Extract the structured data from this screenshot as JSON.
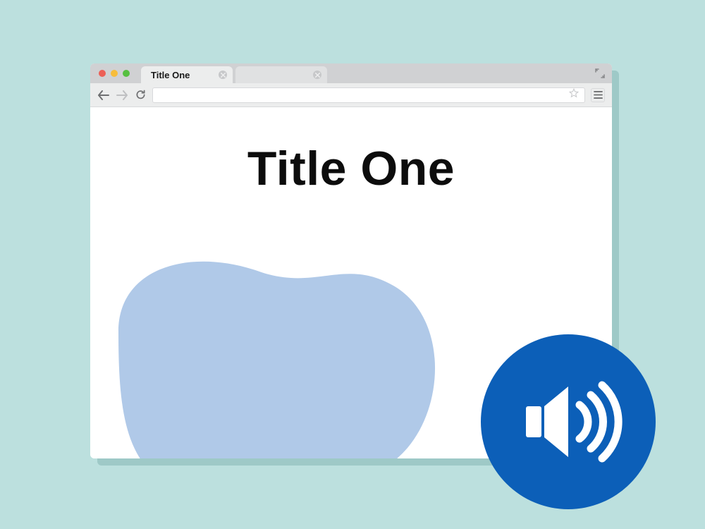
{
  "browser": {
    "tabs": [
      {
        "label": "Title One",
        "active": true
      },
      {
        "label": "",
        "active": false
      }
    ]
  },
  "page": {
    "title": "Title One"
  },
  "colors": {
    "background": "#bce0de",
    "accent": "#0c5fb8",
    "blob": "#b0c9e8"
  }
}
